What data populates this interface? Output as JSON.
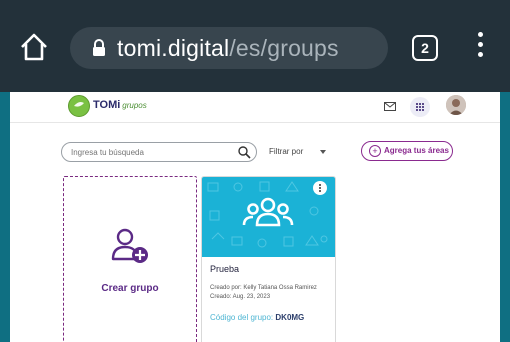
{
  "browser": {
    "url_host": "tomi.digital",
    "url_path": "/es/groups",
    "tab_count": "2"
  },
  "app": {
    "logo_name": "TOMi",
    "logo_sub": "grupos"
  },
  "toolbar": {
    "search_placeholder": "Ingresa tu búsqueda",
    "filter_label": "Filtrar por",
    "add_areas_label": "Agrega tus áreas"
  },
  "create_card": {
    "label": "Crear grupo"
  },
  "group": {
    "name": "Prueba",
    "creator": "Creado por: Kelly Tatiana Ossa Ramirez",
    "created": "Creado: Aug. 23, 2023",
    "code_label": "Código del grupo:",
    "code": "DK0MG"
  },
  "colors": {
    "brand_purple": "#8a2a8f",
    "banner": "#1bb2d6",
    "chrome": "#23313a"
  }
}
